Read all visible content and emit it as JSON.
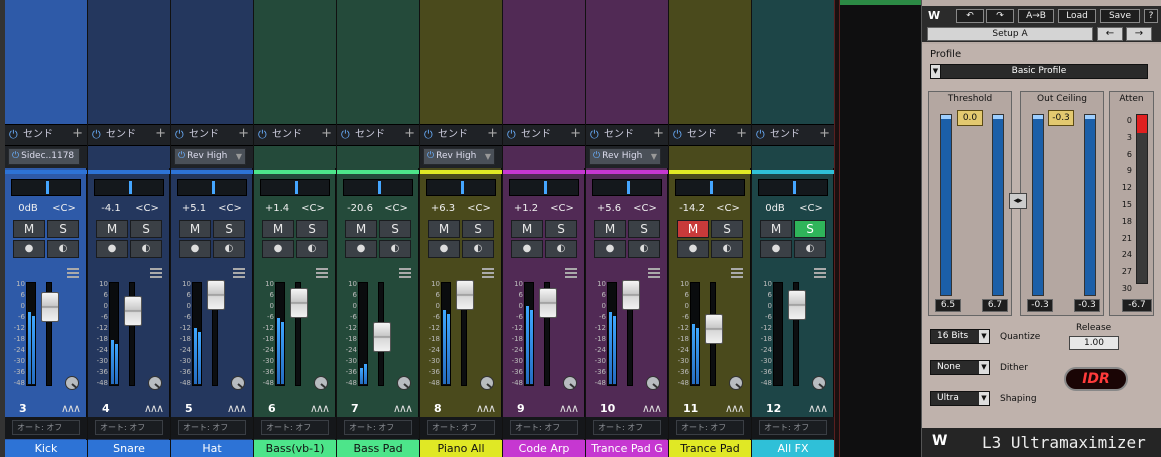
{
  "mixer": {
    "send_label": "センド",
    "auto_label": "オート: オフ",
    "mute_label": "M",
    "solo_label": "S",
    "channels": [
      {
        "num": "3",
        "name": "Kick",
        "volume": "0dB",
        "pan": "<C>",
        "insert": "Sidec..1178",
        "color": "#2e5aa8",
        "name_bg": "#2d73d6",
        "mute_active": false,
        "solo_active": false
      },
      {
        "num": "4",
        "name": "Snare",
        "volume": "-4.1",
        "pan": "<C>",
        "insert": "",
        "color": "#24375e",
        "name_bg": "#2d73d6",
        "mute_active": false,
        "solo_active": false
      },
      {
        "num": "5",
        "name": "Hat",
        "volume": "+5.1",
        "pan": "<C>",
        "insert": "Rev High",
        "color": "#24375e",
        "name_bg": "#2d73d6",
        "mute_active": false,
        "solo_active": false
      },
      {
        "num": "6",
        "name": "Bass(vb-1)",
        "volume": "+1.4",
        "pan": "<C>",
        "insert": "",
        "color": "#244a3a",
        "name_bg": "#4de58a",
        "mute_active": false,
        "solo_active": false
      },
      {
        "num": "7",
        "name": "Bass Pad",
        "volume": "-20.6",
        "pan": "<C>",
        "insert": "",
        "color": "#244a3a",
        "name_bg": "#4de58a",
        "mute_active": false,
        "solo_active": false
      },
      {
        "num": "8",
        "name": "Piano All",
        "volume": "+6.3",
        "pan": "<C>",
        "insert": "Rev High",
        "color": "#4a4a1c",
        "name_bg": "#e0e825",
        "mute_active": false,
        "solo_active": false
      },
      {
        "num": "9",
        "name": "Code Arp",
        "volume": "+1.2",
        "pan": "<C>",
        "insert": "",
        "color": "#512a55",
        "name_bg": "#c637d1",
        "mute_active": false,
        "solo_active": false
      },
      {
        "num": "10",
        "name": "Trance Pad G",
        "volume": "+5.6",
        "pan": "<C>",
        "insert": "Rev High",
        "color": "#512a55",
        "name_bg": "#c637d1",
        "mute_active": false,
        "solo_active": false
      },
      {
        "num": "11",
        "name": "Trance Pad",
        "volume": "-14.2",
        "pan": "<C>",
        "insert": "",
        "color": "#4a4a1c",
        "name_bg": "#e0e825",
        "mute_active": true,
        "solo_active": false
      },
      {
        "num": "12",
        "name": "All FX",
        "volume": "0dB",
        "pan": "<C>",
        "insert": "",
        "color": "#1d4547",
        "name_bg": "#2fc0d8",
        "mute_active": false,
        "solo_active": true
      }
    ],
    "scale": [
      "10",
      "6",
      "0",
      "-6",
      "-12",
      "-18",
      "-24",
      "-30",
      "-36",
      "-48"
    ]
  },
  "plugin": {
    "toolbar": {
      "undo": "↶",
      "redo": "↷",
      "ab": "A→B",
      "load": "Load",
      "save": "Save",
      "help": "?"
    },
    "preset": "Setup A",
    "prev": "←",
    "next": "→",
    "profile_label": "Profile",
    "profile_value": "Basic Profile",
    "threshold": {
      "title": "Threshold",
      "value": "0.0",
      "left": "6.5",
      "right": "6.7"
    },
    "out_ceiling": {
      "title": "Out Ceiling",
      "value": "-0.3",
      "left": "-0.3",
      "right": "-0.3"
    },
    "atten": {
      "title": "Atten",
      "value": "-6.7",
      "scale": [
        "0",
        "3",
        "6",
        "9",
        "12",
        "15",
        "18",
        "21",
        "24",
        "27",
        "30"
      ]
    },
    "quantize": {
      "value": "16 Bits",
      "label": "Quantize"
    },
    "dither": {
      "value": "None",
      "label": "Dither"
    },
    "shaping": {
      "value": "Ultra",
      "label": "Shaping"
    },
    "release": {
      "label": "Release",
      "value": "1.00"
    },
    "idr": "IDR",
    "product": "L3 Ultramaximizer"
  }
}
